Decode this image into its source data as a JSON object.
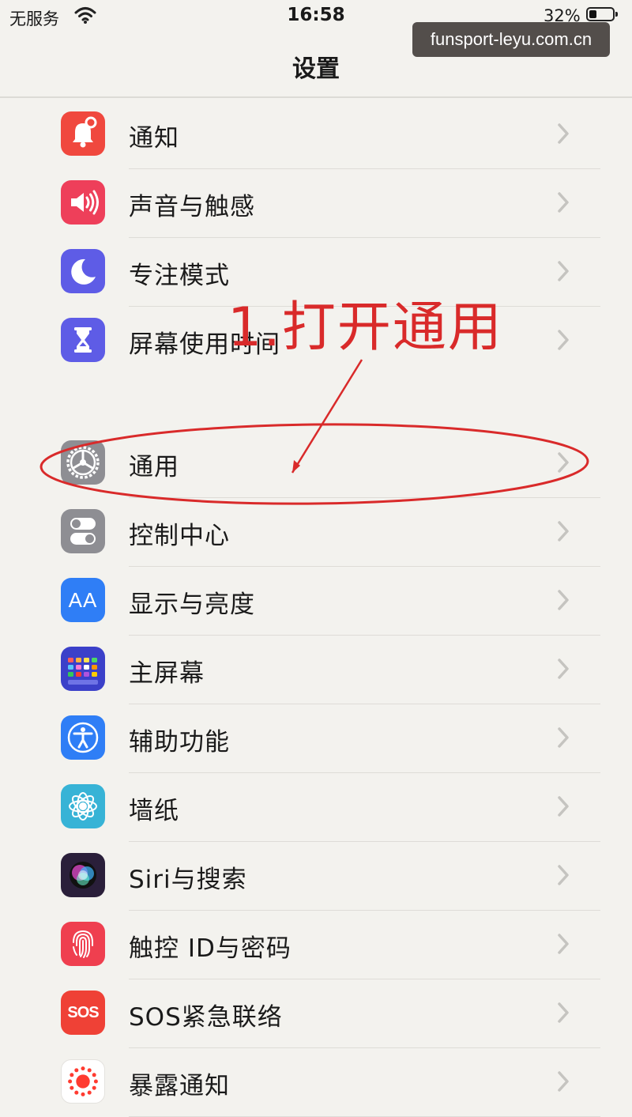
{
  "status_bar": {
    "carrier": "无服务",
    "time": "16:58",
    "battery_percent": "32%",
    "battery_level": 0.32
  },
  "watermark": "funsport-leyu.com.cn",
  "nav": {
    "title": "设置"
  },
  "group1": [
    {
      "label": "通知",
      "icon": "bell-icon",
      "color": "#f0483e"
    },
    {
      "label": "声音与触感",
      "icon": "speaker-icon",
      "color": "#ee3f5a"
    },
    {
      "label": "专注模式",
      "icon": "moon-icon",
      "color": "#5e5ce6"
    },
    {
      "label": "屏幕使用时间",
      "icon": "hourglass-icon",
      "color": "#5e5ce6"
    }
  ],
  "group2": [
    {
      "label": "通用",
      "icon": "gear-icon",
      "color": "#8e8e93"
    },
    {
      "label": "控制中心",
      "icon": "toggle-icon",
      "color": "#8e8e93"
    },
    {
      "label": "显示与亮度",
      "icon": "text-size-icon",
      "color": "#2f7ef6",
      "glyph": "AA"
    },
    {
      "label": "主屏幕",
      "icon": "app-grid-icon",
      "color": "#3b40c9"
    },
    {
      "label": "辅助功能",
      "icon": "accessibility-icon",
      "color": "#2f7ef6"
    },
    {
      "label": "墙纸",
      "icon": "flower-icon",
      "color": "#37b3d6"
    },
    {
      "label": "Siri与搜索",
      "icon": "siri-icon",
      "color": "#2a1f3a"
    },
    {
      "label": "触控 ID与密码",
      "icon": "fingerprint-icon",
      "color": "#ef3f4f"
    },
    {
      "label": "SOS紧急联络",
      "icon": "sos-icon",
      "color": "#ef4136",
      "glyph": "SOS"
    },
    {
      "label": "暴露通知",
      "icon": "exposure-icon",
      "color": "#ffffff"
    }
  ],
  "annotation": {
    "text": "1.打开通用",
    "color": "#d92a2a"
  },
  "colors": {
    "background": "#f3f2ee",
    "separator": "#dedcd7",
    "chevron": "#c5c4c0"
  }
}
